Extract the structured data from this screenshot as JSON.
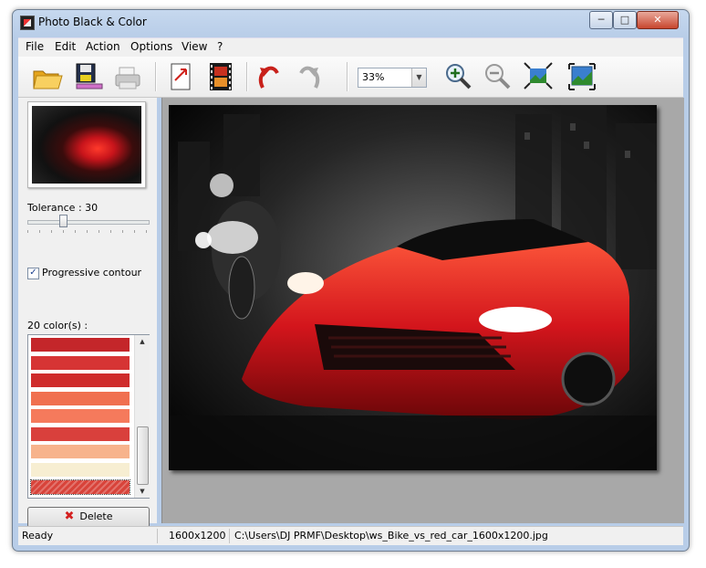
{
  "window": {
    "title": "Photo Black & Color"
  },
  "menu": [
    "File",
    "Edit",
    "Action",
    "Options",
    "View",
    "?"
  ],
  "toolbar": {
    "zoom_value": "33%",
    "icons": [
      "open-folder-icon",
      "save-icon",
      "print-icon",
      "export-icon",
      "film-icon",
      "undo-icon",
      "redo-icon",
      "zoom-in-icon",
      "zoom-out-icon",
      "fit-icon",
      "actual-size-icon"
    ]
  },
  "leftpanel": {
    "tolerance_label": "Tolerance : 30",
    "tolerance_value": 30,
    "progressive_label": "Progressive contour",
    "progressive_checked": true,
    "colors_label": "20 color(s) :",
    "swatches": [
      "#c4262a",
      "#d63434",
      "#cf2c2c",
      "#f07050",
      "#f57a5c",
      "#d9403c",
      "#f7b38c",
      "#f7eed2",
      "#d8433a"
    ],
    "delete_label": "Delete"
  },
  "statusbar": {
    "status": "Ready",
    "dimensions": "1600x1200",
    "path": "C:\\Users\\DJ PRMF\\Desktop\\ws_Bike_vs_red_car_1600x1200.jpg"
  },
  "colors": {
    "frame": "#b8cde8",
    "accent_red": "#d42020"
  }
}
